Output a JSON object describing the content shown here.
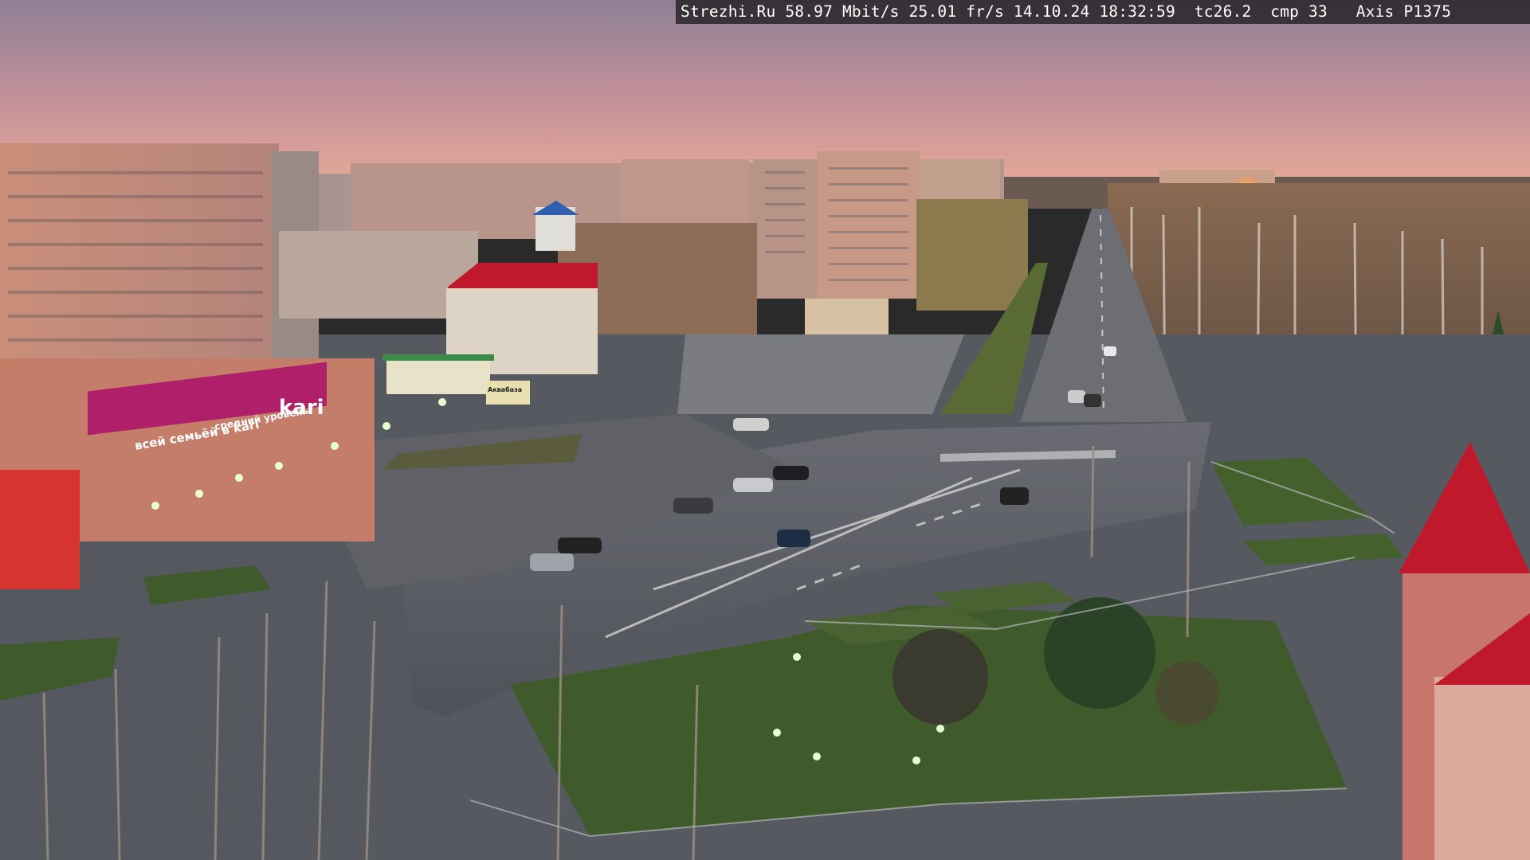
{
  "overlay": {
    "caption": "Strezhi.Ru 58.97 Mbit/s 25.01 fr/s 14.10.24 18:32:59  tc26.2  cmp 33   Axis P1375"
  },
  "signage": {
    "store_logo": "kari",
    "store_banner": "всей семьёй в kari",
    "store_banner_2": "средний уровень",
    "kiosk_sign": "Аквабаза"
  },
  "colors": {
    "sky_top": "#8f7f95",
    "sky_bottom": "#e3a897",
    "asphalt": "#5d6068",
    "grass": "#3d5a2a",
    "store_magenta": "#b0206a",
    "red_roof": "#c0192b"
  }
}
